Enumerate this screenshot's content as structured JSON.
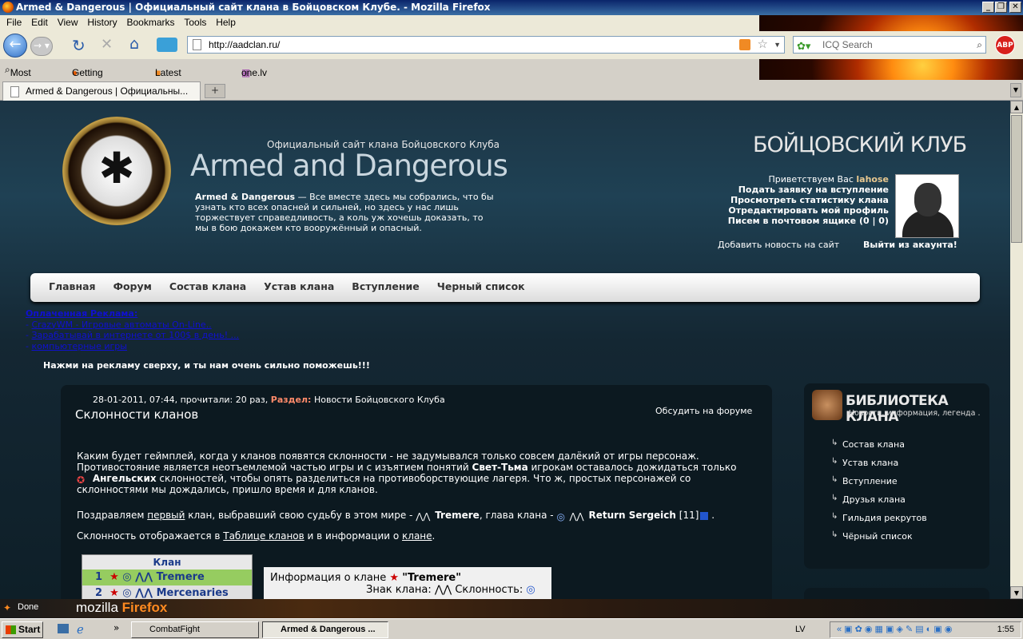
{
  "window": {
    "title": "Armed & Dangerous | Официальный сайт клана в Бойцовском Клубе. - Mozilla Firefox"
  },
  "menu": [
    "File",
    "Edit",
    "View",
    "History",
    "Bookmarks",
    "Tools",
    "Help"
  ],
  "toolbar": {
    "url": "http://aadclan.ru/",
    "search_placeholder": "ICQ Search"
  },
  "bookmarks": [
    "Most Visited",
    "Getting Started",
    "Latest Headlines",
    "one.lv"
  ],
  "tabs": [
    {
      "label": "Armed & Dangerous | Официальны..."
    }
  ],
  "site": {
    "subtitle": "Официальный сайт клана Бойцовского Клуба",
    "title": "Armed and Dangerous",
    "desc_bold": "Armed & Dangerous",
    "desc": " — Все вместе здесь мы собрались, что бы узнать кто всех опасней и сильней, но здесь у нас лишь торжествует справедливость, а коль уж хочешь доказать, то мы в бою докажем кто вооружённый и опасный.",
    "club": "БОЙЦОВСКИЙ КЛУБ",
    "greeting": "Приветствуем Вас",
    "username": "lahose",
    "links": [
      "Подать заявку на вступление",
      "Просмотреть статистику клана",
      "Отредактировать мой профиль",
      "Писем в почтовом ящике (0 | 0)"
    ],
    "add_news": "Добавить новость на сайт",
    "logout": "Выйти из акаунта!"
  },
  "nav": [
    "Главная",
    "Форум",
    "Состав клана",
    "Устав клана",
    "Вступление",
    "Черный список"
  ],
  "ads": {
    "title": "Оплаченная Реклама:",
    "items": [
      "CrazyWM - Игровые автоматы On-Line..",
      "Зарабатывай в интернете от 100$ в день! ...",
      "компьютерные игры"
    ],
    "call": "Нажми на рекламу сверху, и ты нам очень сильно поможешь!!!"
  },
  "article": {
    "meta": "28-01-2011, 07:44, прочитали: 20 раз,",
    "section_label": "Раздел:",
    "section": "Новости Бойцовского Клуба",
    "title": "Склонности кланов",
    "discuss": "Обсудить на форуме",
    "p1a": "Каким будет геймплей, когда у кланов появятся склонности - не задумывался только совсем далёкий от игры персонаж. Противостояние является неотъемлемой частью игры и с изъятием понятий ",
    "p1b": "Свет-Тьма",
    "p1c": " игрокам оставалось дожидаться только ",
    "p1d": "Ангельских",
    "p1e": " склонностей, чтобы опять разделиться на противоборствующие лагеря. Что ж, простых персонажей со склонностями мы дождались, пришло время и для кланов.",
    "p2a": "Поздравляем ",
    "p2link": "первый",
    "p2b": " клан, выбравший свою судьбу в этом мире - ",
    "p2clan": "Tremere",
    "p2c": ", глава клана - ",
    "p2head": "Return Sergeich",
    "p2lvl": " [11]",
    "p3a": "Склонность отображается в ",
    "p3link1": "Таблице кланов",
    "p3b": " и в информации о ",
    "p3link2": "клане",
    "p3c": ".",
    "table_header": "Клан",
    "rows": [
      {
        "n": "1",
        "name": "Tremere"
      },
      {
        "n": "2",
        "name": "Mercenaries"
      }
    ],
    "info_title": "Информация о клане",
    "info_clan": "\"Tremere\"",
    "info_sign": "Знак клана:",
    "info_align": "Склонность:"
  },
  "library": {
    "title": "БИБЛИОТЕКА КЛАНА",
    "subtitle": "Новости, информация, легенда .",
    "items": [
      "Состав клана",
      "Устав клана",
      "Вступление",
      "Друзья клана",
      "Гильдия рекрутов",
      "Чёрный список"
    ]
  },
  "status": {
    "text": "Done",
    "brand1": "mozilla",
    "brand2": "Firefox"
  },
  "taskbar": {
    "start": "Start",
    "tasks": [
      "CombatFight",
      "Armed & Dangerous ..."
    ],
    "lang": "LV",
    "clock": "1:55"
  }
}
